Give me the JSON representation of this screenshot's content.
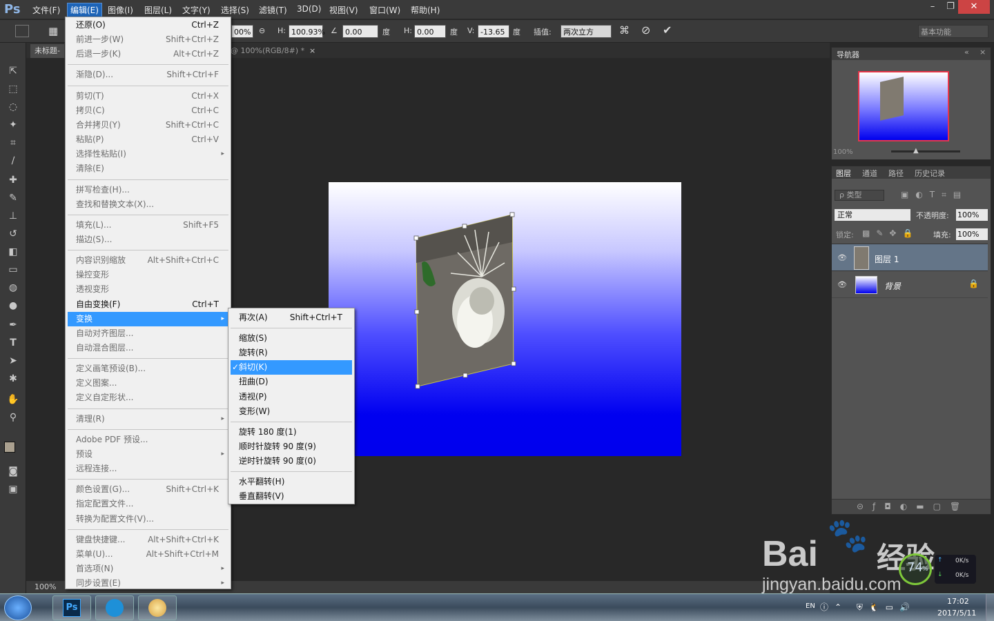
{
  "app": {
    "logo": "Ps"
  },
  "menubar": {
    "items": [
      "文件(F)",
      "编辑(E)",
      "图像(I)",
      "图层(L)",
      "文字(Y)",
      "选择(S)",
      "滤镜(T)",
      "3D(D)",
      "视图(V)",
      "窗口(W)",
      "帮助(H)"
    ],
    "active_index": 1
  },
  "window_controls": {
    "minimize": "–",
    "restore": "❐",
    "close": "✕"
  },
  "options": {
    "w_value": "00%",
    "h_label": "H:",
    "h_value": "100.93%",
    "angle_value": "0.00",
    "deg1": "度",
    "skew_h_label": "H:",
    "skew_h_value": "0.00",
    "deg2": "度",
    "skew_v_label": "V:",
    "skew_v_value": "-13.65",
    "deg3": "度",
    "interp_label": "插值:",
    "interp_value": "两次立方",
    "workspace": "基本功能"
  },
  "doc_tabs": {
    "tab1": "未标题-",
    "tab2": "@ 100%(RGB/8#) *",
    "close": "×"
  },
  "status": {
    "zoom": "100%"
  },
  "edit_menu": [
    {
      "label": "还原(O)",
      "shortcut": "Ctrl+Z",
      "disabled": false
    },
    {
      "label": "前进一步(W)",
      "shortcut": "Shift+Ctrl+Z",
      "disabled": true
    },
    {
      "label": "后退一步(K)",
      "shortcut": "Alt+Ctrl+Z",
      "disabled": true
    },
    {
      "sep": true
    },
    {
      "label": "渐隐(D)...",
      "shortcut": "Shift+Ctrl+F",
      "disabled": true
    },
    {
      "sep": true
    },
    {
      "label": "剪切(T)",
      "shortcut": "Ctrl+X",
      "disabled": true
    },
    {
      "label": "拷贝(C)",
      "shortcut": "Ctrl+C",
      "disabled": true
    },
    {
      "label": "合并拷贝(Y)",
      "shortcut": "Shift+Ctrl+C",
      "disabled": true
    },
    {
      "label": "粘贴(P)",
      "shortcut": "Ctrl+V",
      "disabled": true
    },
    {
      "label": "选择性粘贴(I)",
      "shortcut": "",
      "disabled": true,
      "submenu": true
    },
    {
      "label": "清除(E)",
      "shortcut": "",
      "disabled": true
    },
    {
      "sep": true
    },
    {
      "label": "拼写检查(H)...",
      "shortcut": "",
      "disabled": true
    },
    {
      "label": "查找和替换文本(X)...",
      "shortcut": "",
      "disabled": true
    },
    {
      "sep": true
    },
    {
      "label": "填充(L)...",
      "shortcut": "Shift+F5",
      "disabled": true
    },
    {
      "label": "描边(S)...",
      "shortcut": "",
      "disabled": true
    },
    {
      "sep": true
    },
    {
      "label": "内容识别缩放",
      "shortcut": "Alt+Shift+Ctrl+C",
      "disabled": true
    },
    {
      "label": "操控变形",
      "shortcut": "",
      "disabled": true
    },
    {
      "label": "透视变形",
      "shortcut": "",
      "disabled": true
    },
    {
      "label": "自由变换(F)",
      "shortcut": "Ctrl+T",
      "disabled": false
    },
    {
      "label": "变换",
      "shortcut": "",
      "disabled": false,
      "submenu": true,
      "highlight": true
    },
    {
      "label": "自动对齐图层...",
      "shortcut": "",
      "disabled": true
    },
    {
      "label": "自动混合图层...",
      "shortcut": "",
      "disabled": true
    },
    {
      "sep": true
    },
    {
      "label": "定义画笔预设(B)...",
      "shortcut": "",
      "disabled": true
    },
    {
      "label": "定义图案...",
      "shortcut": "",
      "disabled": true
    },
    {
      "label": "定义自定形状...",
      "shortcut": "",
      "disabled": true
    },
    {
      "sep": true
    },
    {
      "label": "清理(R)",
      "shortcut": "",
      "disabled": true,
      "submenu": true
    },
    {
      "sep": true
    },
    {
      "label": "Adobe PDF 预设...",
      "shortcut": "",
      "disabled": true
    },
    {
      "label": "预设",
      "shortcut": "",
      "disabled": true,
      "submenu": true
    },
    {
      "label": "远程连接...",
      "shortcut": "",
      "disabled": true
    },
    {
      "sep": true
    },
    {
      "label": "颜色设置(G)...",
      "shortcut": "Shift+Ctrl+K",
      "disabled": true
    },
    {
      "label": "指定配置文件...",
      "shortcut": "",
      "disabled": true
    },
    {
      "label": "转换为配置文件(V)...",
      "shortcut": "",
      "disabled": true
    },
    {
      "sep": true
    },
    {
      "label": "键盘快捷键...",
      "shortcut": "Alt+Shift+Ctrl+K",
      "disabled": true
    },
    {
      "label": "菜单(U)...",
      "shortcut": "Alt+Shift+Ctrl+M",
      "disabled": true
    },
    {
      "label": "首选项(N)",
      "shortcut": "",
      "disabled": true,
      "submenu": true
    },
    {
      "label": "同步设置(E)",
      "shortcut": "",
      "disabled": true,
      "submenu": true
    }
  ],
  "transform_menu": [
    {
      "label": "再次(A)",
      "shortcut": "Shift+Ctrl+T"
    },
    {
      "sep": true
    },
    {
      "label": "缩放(S)",
      "shortcut": ""
    },
    {
      "label": "旋转(R)",
      "shortcut": ""
    },
    {
      "label": "斜切(K)",
      "shortcut": "",
      "checked": true,
      "highlight": true
    },
    {
      "label": "扭曲(D)",
      "shortcut": ""
    },
    {
      "label": "透视(P)",
      "shortcut": ""
    },
    {
      "label": "变形(W)",
      "shortcut": ""
    },
    {
      "sep": true
    },
    {
      "label": "旋转 180 度(1)",
      "shortcut": ""
    },
    {
      "label": "顺时针旋转 90 度(9)",
      "shortcut": ""
    },
    {
      "label": "逆时针旋转 90 度(0)",
      "shortcut": ""
    },
    {
      "sep": true
    },
    {
      "label": "水平翻转(H)",
      "shortcut": ""
    },
    {
      "label": "垂直翻转(V)",
      "shortcut": ""
    }
  ],
  "check_mark": "✓",
  "submenu_arrow": "▸",
  "navigator": {
    "title": "导航器",
    "zoom": "100%"
  },
  "layers_panel": {
    "tabs": [
      "图层",
      "通道",
      "路径",
      "历史记录"
    ],
    "filter_label": "ρ 类型",
    "blend_mode": "正常",
    "opacity_label": "不透明度:",
    "opacity_value": "100%",
    "lock_label": "锁定:",
    "fill_label": "填充:",
    "fill_value": "100%",
    "layers": [
      {
        "name": "图层 1",
        "selected": true
      },
      {
        "name": "背景",
        "selected": false,
        "locked": true
      }
    ]
  },
  "watermark": {
    "brand": "Bai",
    "brand2": "经验",
    "url": "jingyan.baidu.com"
  },
  "net_widget": {
    "percent": "74",
    "percent_sign": "%",
    "up": "0K/s",
    "down": "0K/s"
  },
  "taskbar": {
    "lang": "EN",
    "time": "17:02",
    "date": "2017/5/11"
  },
  "colors": {
    "accent": "#3399ff",
    "menu_active": "#1d64b8",
    "canvas_blue": "#0000ee"
  }
}
